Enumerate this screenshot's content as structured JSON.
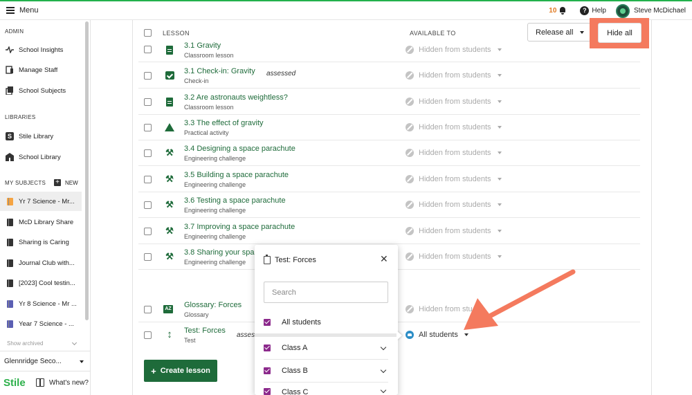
{
  "topbar": {
    "menu_label": "Menu",
    "notification_count": "10",
    "help_label": "Help",
    "user_name": "Steve McDichael"
  },
  "sidebar": {
    "admin_heading": "ADMIN",
    "admin_items": [
      "School Insights",
      "Manage Staff",
      "School Subjects"
    ],
    "libraries_heading": "LIBRARIES",
    "library_items": [
      "Stile Library",
      "School Library"
    ],
    "subjects_heading": "MY SUBJECTS",
    "new_label": "NEW",
    "subject_items": [
      "Yr 7 Science - Mr...",
      "McD Library Share",
      "Sharing is Caring",
      "Journal Club with...",
      "[2023] Cool testin...",
      "Yr 8 Science - Mr ...",
      "Year 7 Science - ..."
    ],
    "show_archived": "Show archived",
    "school_name": "Glennridge Seco...",
    "logo": "Stile",
    "whats_new": "What's new?"
  },
  "table": {
    "col_lesson": "LESSON",
    "col_available": "AVAILABLE TO",
    "release_all": "Release all",
    "hide_all": "Hide all",
    "rows": [
      {
        "title": "3.1 Gravity",
        "sub": "Classroom lesson",
        "assessed": "",
        "avail": "Hidden from students"
      },
      {
        "title": "3.1 Check-in: Gravity",
        "sub": "Check-in",
        "assessed": "assessed",
        "avail": "Hidden from students"
      },
      {
        "title": "3.2 Are astronauts weightless?",
        "sub": "Classroom lesson",
        "assessed": "",
        "avail": "Hidden from students"
      },
      {
        "title": "3.3 The effect of gravity",
        "sub": "Practical activity",
        "assessed": "",
        "avail": "Hidden from students"
      },
      {
        "title": "3.4 Designing a space parachute",
        "sub": "Engineering challenge",
        "assessed": "",
        "avail": "Hidden from students"
      },
      {
        "title": "3.5 Building a space parachute",
        "sub": "Engineering challenge",
        "assessed": "",
        "avail": "Hidden from students"
      },
      {
        "title": "3.6 Testing a space parachute",
        "sub": "Engineering challenge",
        "assessed": "",
        "avail": "Hidden from students"
      },
      {
        "title": "3.7 Improving a space parachute",
        "sub": "Engineering challenge",
        "assessed": "",
        "avail": "Hidden from students"
      },
      {
        "title": "3.8 Sharing your spa",
        "sub": "Engineering challenge",
        "assessed": "",
        "avail": "Hidden from students"
      },
      {
        "title": "Glossary: Forces",
        "sub": "Glossary",
        "assessed": "",
        "avail": "Hidden from stu"
      },
      {
        "title": "Test: Forces",
        "sub": "Test",
        "assessed": "asses",
        "avail": "All students"
      }
    ],
    "create_lesson": "Create lesson"
  },
  "popup": {
    "title": "Test: Forces",
    "search_placeholder": "Search",
    "all_students": "All students",
    "classes": [
      "Class A",
      "Class B",
      "Class C"
    ]
  },
  "colors": {
    "brand_green": "#1e6b3a",
    "highlight": "#f47a5e",
    "checkbox_purple": "#8c2a8c",
    "accent_bar": "#22b14c"
  }
}
